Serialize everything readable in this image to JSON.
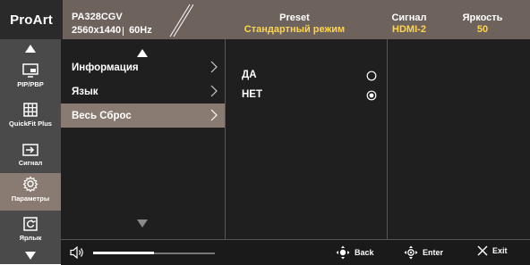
{
  "header": {
    "logo": "ProArt",
    "model": "PA328CGV",
    "resolution": "2560x1440",
    "refresh": "60Hz",
    "preset_label": "Preset",
    "preset_value": "Стандартный режим",
    "signal_label": "Сигнал",
    "signal_value": "HDMI-2",
    "brightness_label": "Яркость",
    "brightness_value": "50"
  },
  "sidebar": {
    "items": [
      {
        "label": "PIP/PBP",
        "icon": "pip-icon"
      },
      {
        "label": "QuickFit Plus",
        "icon": "grid-icon"
      },
      {
        "label": "Сигнал",
        "icon": "input-icon"
      },
      {
        "label": "Параметры",
        "icon": "gear-icon",
        "active": true
      },
      {
        "label": "Ярлык",
        "icon": "shortcut-icon"
      }
    ]
  },
  "menu": {
    "items": [
      {
        "label": "Информация"
      },
      {
        "label": "Язык"
      },
      {
        "label": "Весь Сброс",
        "selected": true
      }
    ]
  },
  "options": {
    "items": [
      {
        "label": "ДА",
        "checked": false
      },
      {
        "label": "НЕТ",
        "checked": true
      }
    ]
  },
  "footer": {
    "volume_level": 0.5,
    "back_label": "Back",
    "enter_label": "Enter",
    "exit_label": "Exit"
  },
  "colors": {
    "accent_value": "#ffd54a",
    "header_bg": "#6d625c",
    "selection": "#8a7b72"
  }
}
